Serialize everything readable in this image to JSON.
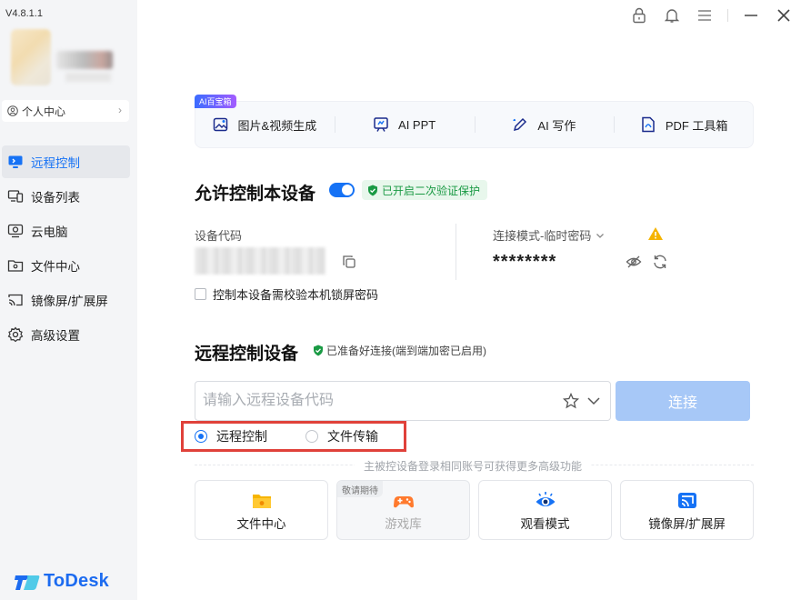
{
  "sidebar": {
    "version": "V4.8.1.1",
    "personal_center": "个人中心",
    "items": [
      {
        "label": "远程控制",
        "icon": "monitor-icon",
        "active": true
      },
      {
        "label": "设备列表",
        "icon": "device-list-icon"
      },
      {
        "label": "云电脑",
        "icon": "cloud-pc-icon"
      },
      {
        "label": "文件中心",
        "icon": "folder-icon"
      },
      {
        "label": "镜像屏/扩展屏",
        "icon": "cast-icon"
      },
      {
        "label": "高级设置",
        "icon": "gear-icon"
      }
    ],
    "brand": "ToDesk"
  },
  "ai_toolbox": {
    "tag": "AI百宝箱",
    "items": [
      {
        "label": "图片&视频生成",
        "icon": "image-gen-icon"
      },
      {
        "label": "AI PPT",
        "icon": "ppt-icon"
      },
      {
        "label": "AI 写作",
        "icon": "pen-icon"
      },
      {
        "label": "PDF 工具箱",
        "icon": "pdf-icon"
      }
    ]
  },
  "allow_control": {
    "title": "允许控制本设备",
    "enabled": true,
    "security_badge": "已开启二次验证保护",
    "device_code_label": "设备代码",
    "connection_mode_label": "连接模式-临时密码",
    "password": "********",
    "lock_check_label": "控制本设备需校验本机锁屏密码"
  },
  "remote_control": {
    "title": "远程控制设备",
    "ready_text": "已准备好连接(端到端加密已启用)",
    "input_placeholder": "请输入远程设备代码",
    "connect_label": "连接",
    "modes": [
      {
        "label": "远程控制",
        "selected": true
      },
      {
        "label": "文件传输",
        "selected": false
      }
    ],
    "hint": "主被控设备登录相同账号可获得更多高级功能",
    "cards": [
      {
        "label": "文件中心",
        "icon": "folder-icon"
      },
      {
        "label": "游戏库",
        "icon": "gamepad-icon",
        "badge": "敬请期待",
        "disabled": true
      },
      {
        "label": "观看模式",
        "icon": "eye-icon"
      },
      {
        "label": "镜像屏/扩展屏",
        "icon": "cast-icon"
      }
    ]
  },
  "colors": {
    "accent": "#1672f5",
    "success": "#1a9a44",
    "highlight_box": "#e0413a"
  }
}
